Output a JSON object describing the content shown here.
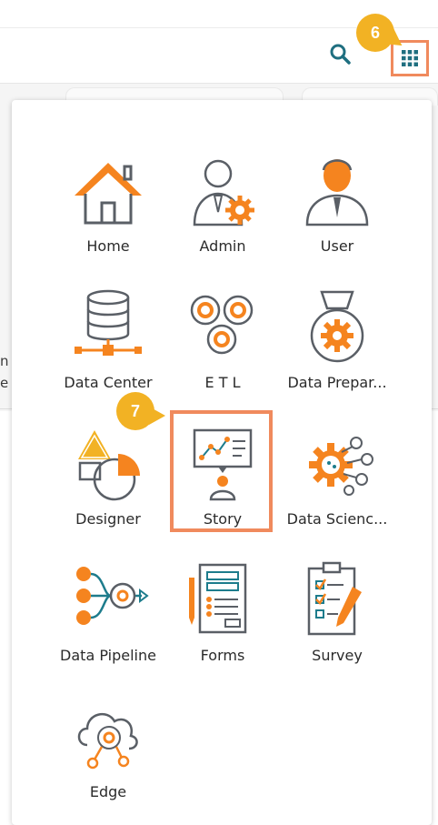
{
  "header": {
    "search_icon": "search-icon",
    "apps_icon": "grid-apps-icon"
  },
  "background": {
    "left_letters": [
      "n",
      "e"
    ]
  },
  "badges": {
    "step6": "6",
    "step7": "7"
  },
  "apps": [
    {
      "label": "Home",
      "icon": "home-icon"
    },
    {
      "label": "Admin",
      "icon": "admin-icon"
    },
    {
      "label": "User",
      "icon": "user-icon"
    },
    {
      "label": "Data Center",
      "icon": "data-center-icon"
    },
    {
      "label": "E T L",
      "icon": "etl-icon"
    },
    {
      "label": "Data Prepar...",
      "icon": "data-preparation-icon"
    },
    {
      "label": "Designer",
      "icon": "designer-icon"
    },
    {
      "label": "Story",
      "icon": "story-icon"
    },
    {
      "label": "Data Scienc...",
      "icon": "data-science-icon"
    },
    {
      "label": "Data Pipeline",
      "icon": "data-pipeline-icon"
    },
    {
      "label": "Forms",
      "icon": "forms-icon"
    },
    {
      "label": "Survey",
      "icon": "survey-icon"
    },
    {
      "label": "Edge",
      "icon": "edge-icon"
    }
  ],
  "colors": {
    "accent_orange": "#f08a5d",
    "icon_orange": "#f5841f",
    "badge_yellow": "#f2b224",
    "icon_outline": "#5a5f66",
    "icon_teal": "#1d7c8c"
  }
}
